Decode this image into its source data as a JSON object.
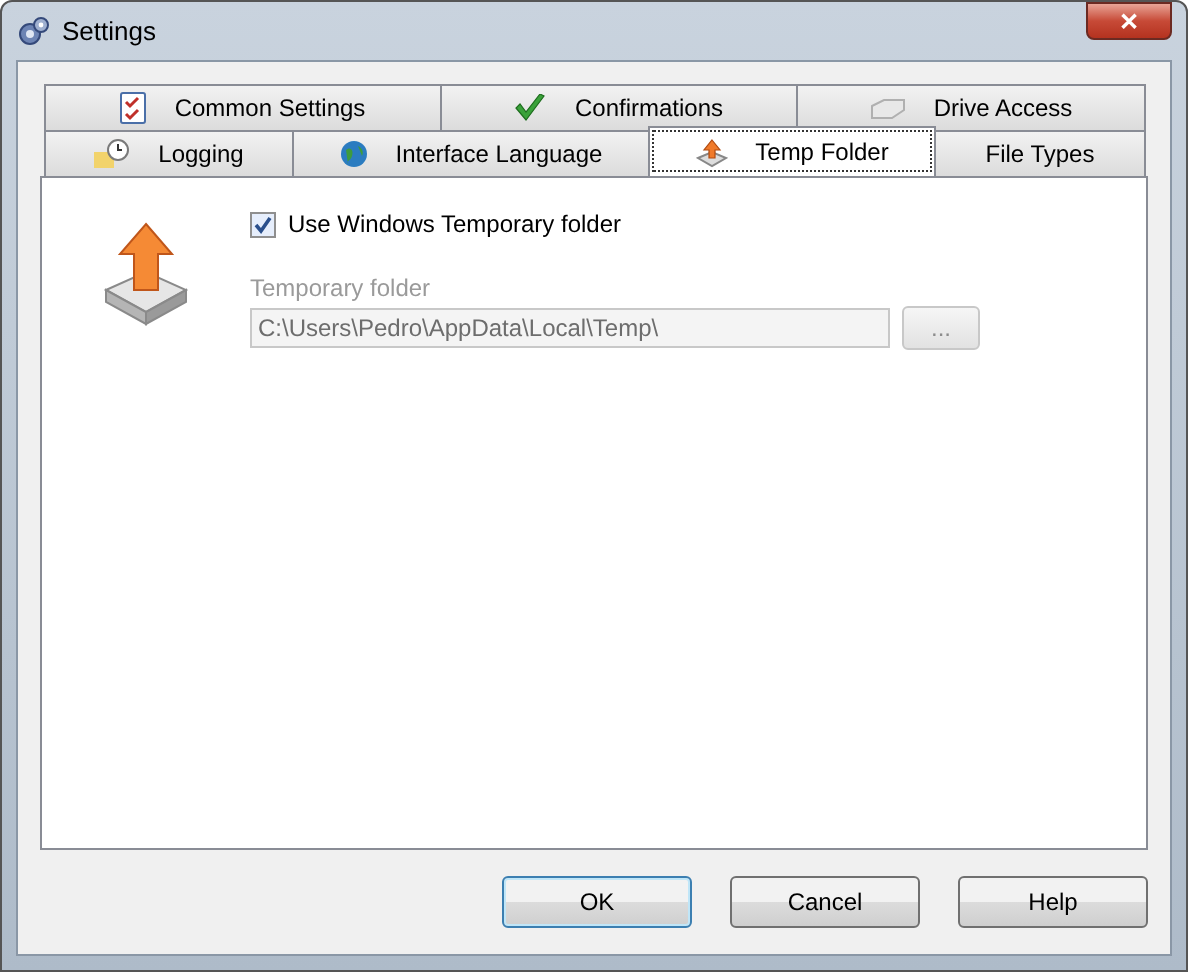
{
  "window": {
    "title": "Settings",
    "close": "✕"
  },
  "tab_rows": [
    [
      {
        "label": "Common Settings",
        "selected": false
      },
      {
        "label": "Confirmations",
        "selected": false
      },
      {
        "label": "Drive Access",
        "selected": false
      }
    ],
    [
      {
        "label": "Logging",
        "selected": false
      },
      {
        "label": "Interface Language",
        "selected": false
      },
      {
        "label": "Temp Folder",
        "selected": true
      },
      {
        "label": "File Types",
        "selected": false
      }
    ]
  ],
  "use_windows_temp": {
    "label": "Use Windows Temporary folder",
    "checked": true
  },
  "temp_folder": {
    "label": "Temporary folder",
    "value": "C:\\Users\\Pedro\\AppData\\Local\\Temp\\",
    "disabled": true,
    "browse": "..."
  },
  "buttons": [
    "OK",
    "Cancel",
    "Help"
  ]
}
